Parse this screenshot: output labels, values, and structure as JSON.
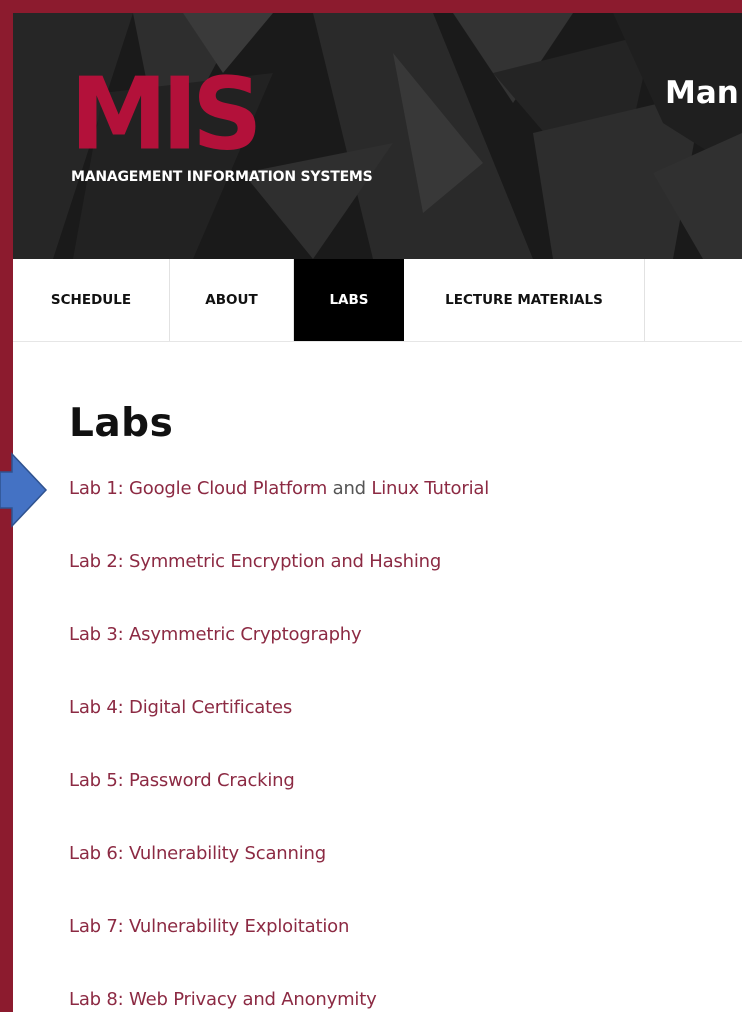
{
  "colors": {
    "frame": "#8c1b2e",
    "logo_red": "#b3113a",
    "link": "#8c2a43",
    "arrow": "#4472c4"
  },
  "header": {
    "logo_text": "MIS",
    "logo_subtitle": "MANAGEMENT INFORMATION SYSTEMS",
    "title_partial": "Man"
  },
  "nav": {
    "items": [
      {
        "label": "SCHEDULE",
        "active": false
      },
      {
        "label": "ABOUT",
        "active": false
      },
      {
        "label": "LABS",
        "active": true
      },
      {
        "label": "LECTURE MATERIALS",
        "active": false
      }
    ]
  },
  "main": {
    "heading": "Labs",
    "lab1": {
      "link1": "Lab 1: Google Cloud Platform",
      "joiner": " and ",
      "link2": "Linux Tutorial"
    },
    "labs": [
      "Lab 2: Symmetric Encryption and Hashing",
      "Lab 3: Asymmetric Cryptography",
      "Lab 4: Digital Certificates",
      "Lab 5: Password Cracking",
      "Lab 6: Vulnerability Scanning",
      "Lab 7: Vulnerability Exploitation",
      "Lab 8: Web Privacy and Anonymity"
    ]
  },
  "annotation": {
    "icon": "right-arrow-icon"
  }
}
